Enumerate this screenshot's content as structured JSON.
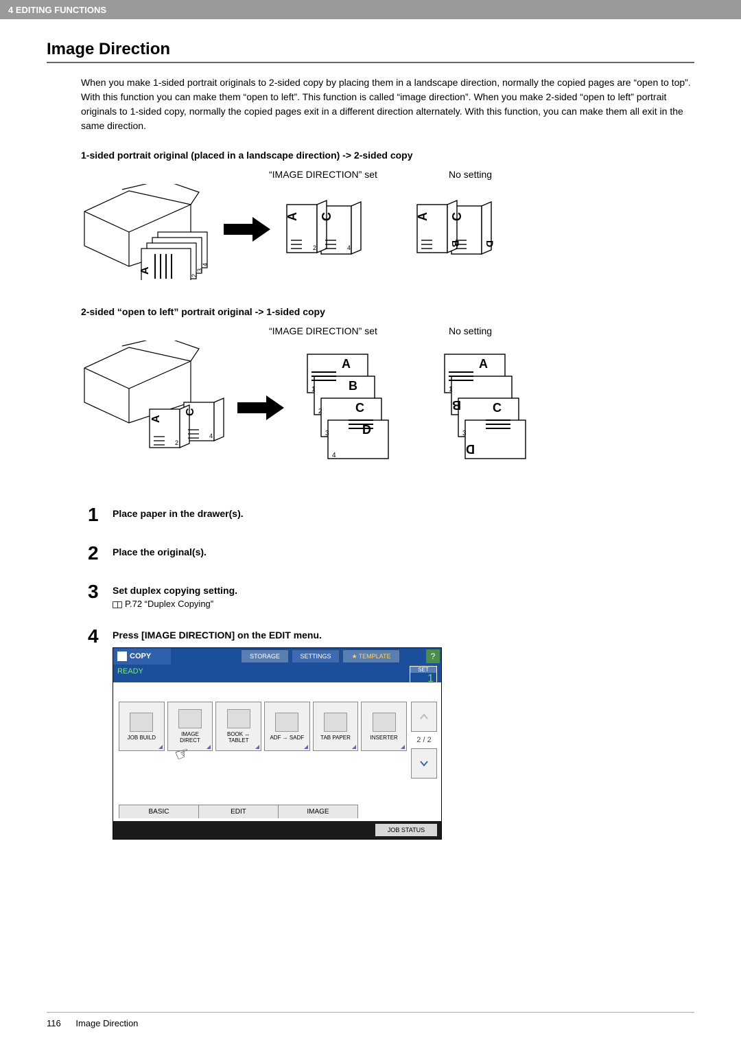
{
  "header": {
    "breadcrumb": "4 EDITING FUNCTIONS"
  },
  "title": "Image Direction",
  "intro": "When you make 1-sided portrait originals to 2-sided copy by placing them in a landscape direction, normally the copied pages are “open to top”. With this function you can make them “open to left”. This function is called “image direction”. When you make 2-sided “open to left” portrait originals to 1-sided copy, normally the copied pages exit in a different direction alternately. With this function, you can make them all exit in the same direction.",
  "sub1": "1-sided portrait original (placed in a landscape direction) -> 2-sided copy",
  "sub2": "2-sided “open to left” portrait original -> 1-sided copy",
  "labelSet": "“IMAGE DIRECTION” set",
  "labelNoSet": "No setting",
  "steps": [
    {
      "num": "1",
      "title": "Place paper in the drawer(s)."
    },
    {
      "num": "2",
      "title": "Place the original(s)."
    },
    {
      "num": "3",
      "title": "Set duplex copying setting.",
      "sub": "P.72 “Duplex Copying”"
    },
    {
      "num": "4",
      "title": "Press [IMAGE DIRECTION] on the EDIT menu."
    }
  ],
  "panel": {
    "copy": "COPY",
    "storage": "STORAGE",
    "settings": "SETTINGS",
    "template": "TEMPLATE",
    "help": "?",
    "ready": "READY",
    "setLabel": "SET",
    "setValue": "1",
    "buttons": {
      "jobBuild": "JOB BUILD",
      "imageDirect": "IMAGE DIRECT",
      "bookTablet": "BOOK ↔ TABLET",
      "adfSadf": "ADF → SADF",
      "tabPaper": "TAB PAPER",
      "inserter": "INSERTER"
    },
    "pageInd": "2 / 2",
    "tabs": {
      "basic": "BASIC",
      "edit": "EDIT",
      "image": "IMAGE"
    },
    "jobStatus": "JOB STATUS"
  },
  "footer": {
    "page": "116",
    "title": "Image Direction"
  }
}
